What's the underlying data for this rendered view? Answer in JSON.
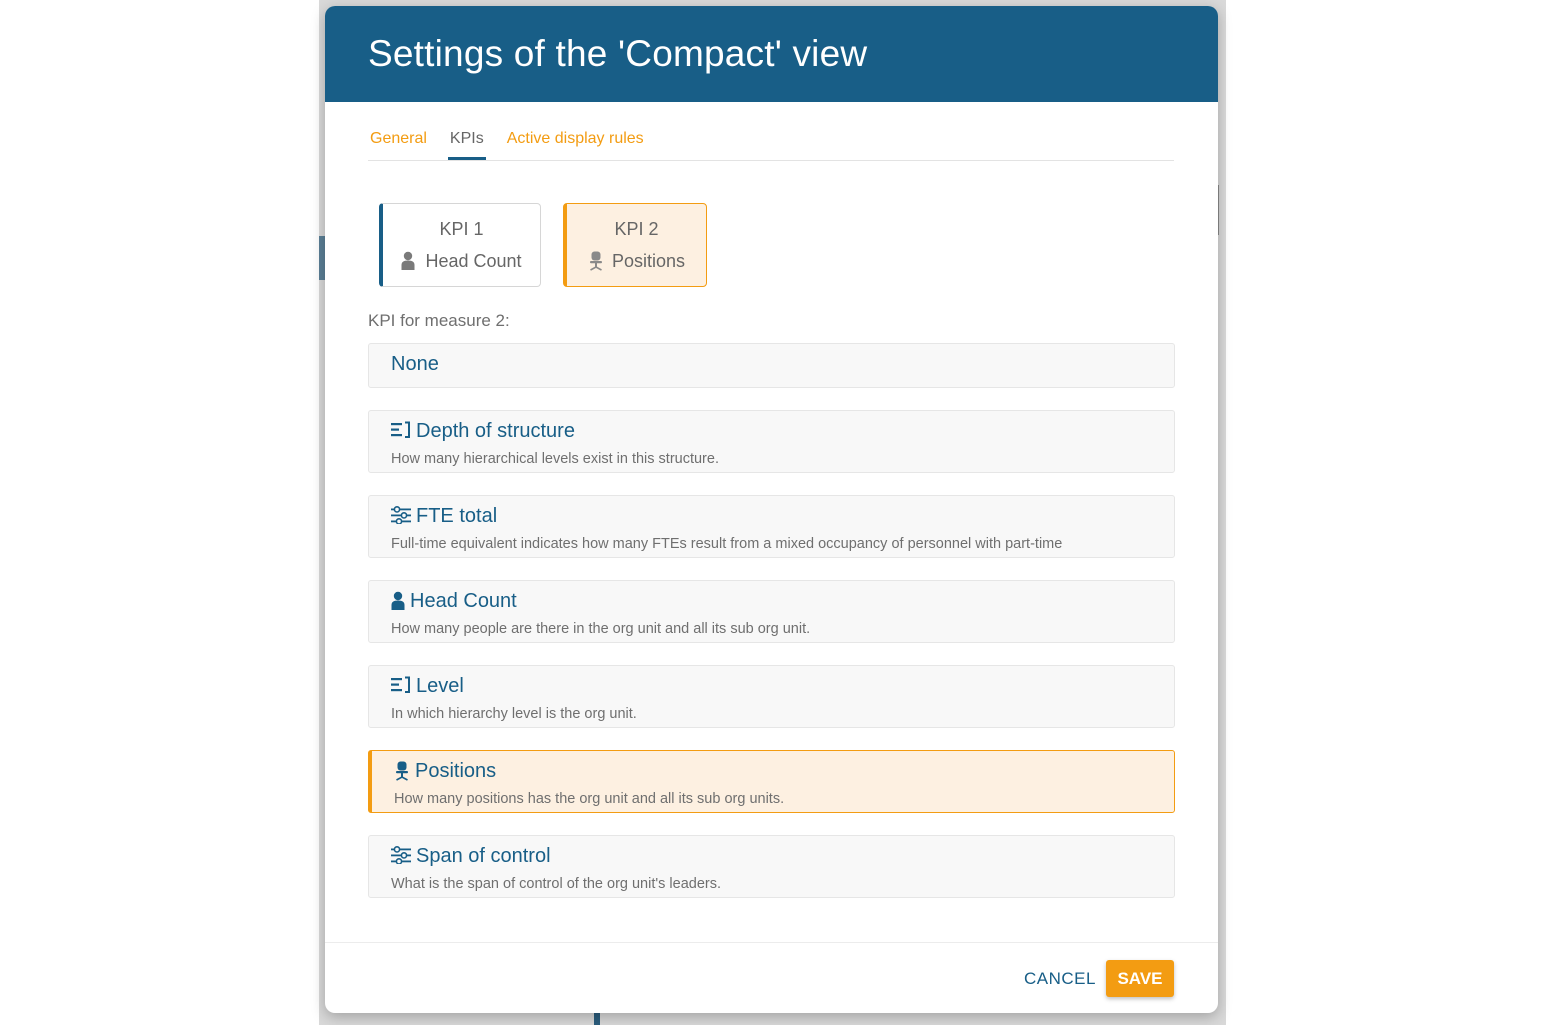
{
  "dialog": {
    "title": "Settings of the 'Compact' view"
  },
  "tabs": [
    {
      "label": "General"
    },
    {
      "label": "KPIs"
    },
    {
      "label": "Active display rules"
    }
  ],
  "kpi_slots": [
    {
      "label": "KPI 1",
      "name": "Head Count",
      "icon": "person-icon"
    },
    {
      "label": "KPI 2",
      "name": "Positions",
      "icon": "office-chair-icon"
    }
  ],
  "measure_label": "KPI for measure 2:",
  "options": [
    {
      "title": "None",
      "description": ""
    },
    {
      "title": "Depth of structure",
      "description": "How many hierarchical levels exist in this structure.",
      "icon": "hierarchy-levels-icon"
    },
    {
      "title": "FTE total",
      "description": "Full-time equivalent indicates how many FTEs result from a mixed occupancy of personnel with part-time",
      "icon": "sliders-icon"
    },
    {
      "title": "Head Count",
      "description": "How many people are there in the org unit and all its sub org unit.",
      "icon": "person-icon"
    },
    {
      "title": "Level",
      "description": "In which hierarchy level is the org unit.",
      "icon": "hierarchy-levels-icon"
    },
    {
      "title": "Positions",
      "description": "How many positions has the org unit and all its sub org units.",
      "icon": "office-chair-icon"
    },
    {
      "title": "Span of control",
      "description": "What is the span of control of the org unit's leaders.",
      "icon": "sliders-icon"
    }
  ],
  "footer": {
    "cancel_label": "CANCEL",
    "save_label": "SAVE"
  },
  "colors": {
    "header": "#185e87",
    "accent": "#f39c12",
    "selected_bg": "#fdf0e1"
  }
}
